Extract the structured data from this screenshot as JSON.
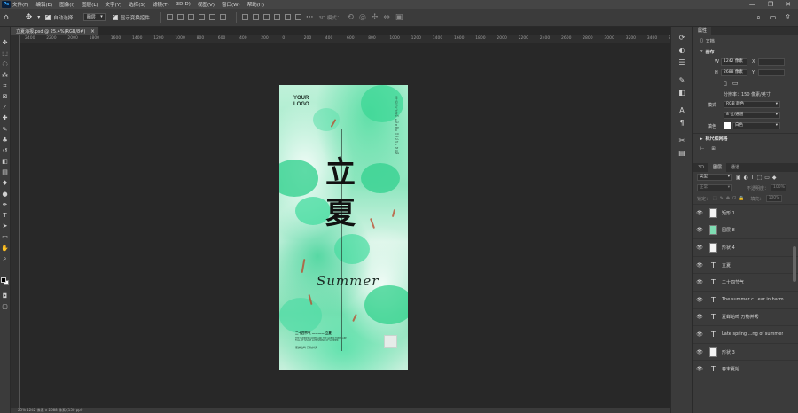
{
  "menubar": {
    "logo": "Ps",
    "items": [
      "文件(F)",
      "编辑(E)",
      "图像(I)",
      "图层(L)",
      "文字(Y)",
      "选择(S)",
      "滤镜(T)",
      "3D(D)",
      "视图(V)",
      "窗口(W)",
      "帮助(H)"
    ],
    "window_controls": [
      "—",
      "❐",
      "✕"
    ]
  },
  "options": {
    "auto_select_label": "自动选择：",
    "auto_select_value": "图层",
    "show_transform_label": "显示变换控件",
    "mode_3d_label": "3D 模式："
  },
  "document": {
    "tab_title": "立夏海报.psd @ 25.4%(RGB/8#)",
    "ruler_labels": [
      "2400",
      "2200",
      "2000",
      "1800",
      "1600",
      "1400",
      "1200",
      "1000",
      "800",
      "600",
      "400",
      "200",
      "0",
      "200",
      "400",
      "600",
      "800",
      "1000",
      "1200",
      "1400",
      "1600",
      "1800",
      "2000",
      "2200",
      "2400",
      "2600",
      "2800",
      "3000",
      "3200",
      "3400",
      "3600"
    ],
    "status": "25%   1242 像素 x 2688 像素 (150 ppi)"
  },
  "poster": {
    "logo": "YOUR\nLOGO",
    "vertical_text": "二十四节气 立夏 THE SUMMER COMES LATE SPRING",
    "title": "立\n夏",
    "script": "Summer",
    "footer_line1": "二十四节气 ———— 立夏",
    "footer_small": "THE SUMMER COMES AND THE GREEN TREES ARE FULL OF SHADE LATE SPRING OF SUMMER",
    "footer_line3": "夏蝉始鸣   万物并秀"
  },
  "panels": {
    "properties": {
      "tab": "属性",
      "doc_label": "文档",
      "canvas_head": "画布",
      "w_label": "W",
      "w_value": "1242 像素",
      "x_label": "X",
      "h_label": "H",
      "h_value": "2688 像素",
      "y_label": "Y",
      "resolution": "分辨率：150 像素/英寸",
      "mode_label": "模式",
      "mode_value": "RGB 颜色",
      "depth_value": "8 位/通道",
      "fill_label": "填色",
      "fill_value": "白色",
      "rulers_head": "标尺和网格"
    },
    "layers": {
      "tabs": [
        "3D",
        "图层",
        "通道"
      ],
      "filter_label": "类型",
      "blend_mode": "正常",
      "opacity_label": "不透明度：",
      "opacity_value": "100%",
      "lock_label": "锁定：",
      "fill_label": "填充：",
      "fill_value": "100%",
      "items": [
        {
          "type": "thumb",
          "name": "矩形 1"
        },
        {
          "type": "thumb",
          "name": "图层 8"
        },
        {
          "type": "thumb",
          "name": "形状 4"
        },
        {
          "type": "text",
          "name": "立夏"
        },
        {
          "type": "text",
          "name": "二十四节气"
        },
        {
          "type": "text",
          "name": "The summer c...ear in harm"
        },
        {
          "type": "text",
          "name": "夏蝉始鸣 万物并秀"
        },
        {
          "type": "text",
          "name": "Late spring ...ng of summer"
        },
        {
          "type": "thumb",
          "name": "形状 3"
        },
        {
          "type": "text",
          "name": "春末夏始"
        }
      ]
    }
  }
}
